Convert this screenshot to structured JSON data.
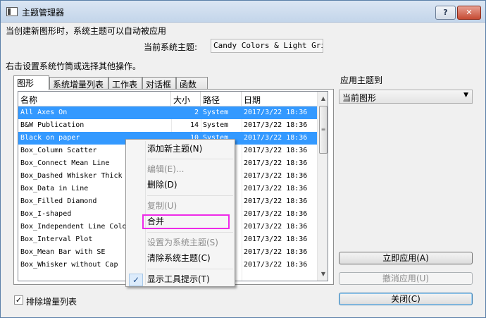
{
  "window": {
    "title": "主题管理器",
    "help_label": "?",
    "close_label": "✕"
  },
  "auto_apply_text": "当创建新图形时，系统主题可以自动被应用",
  "current_theme": {
    "label": "当前系统主题:",
    "value": "Candy Colors & Light Grids"
  },
  "instruction": "右击设置系统竹筒或选择其他操作。",
  "tabs": [
    {
      "label": "图形",
      "active": true
    },
    {
      "label": "系统增量列表",
      "active": false
    },
    {
      "label": "工作表",
      "active": false
    },
    {
      "label": "对话框",
      "active": false
    },
    {
      "label": "函数",
      "active": false
    }
  ],
  "table": {
    "columns": [
      "名称",
      "大小",
      "路径",
      "日期"
    ],
    "rows": [
      {
        "name": "All Axes On",
        "size": "2",
        "path": "System",
        "date": "2017/3/22 18:36",
        "selected": true
      },
      {
        "name": "B&W Publication",
        "size": "14",
        "path": "System",
        "date": "2017/3/22 18:36",
        "selected": false
      },
      {
        "name": "Black on paper",
        "size": "10",
        "path": "System",
        "date": "2017/3/22 18:36",
        "selected": true
      },
      {
        "name": "Box_Column Scatter",
        "size": "",
        "path": "",
        "date": "2017/3/22 18:36",
        "selected": false
      },
      {
        "name": "Box_Connect Mean Line",
        "size": "",
        "path": "",
        "date": "2017/3/22 18:36",
        "selected": false
      },
      {
        "name": "Box_Dashed Whisker Thick",
        "size": "",
        "path": "",
        "date": "2017/3/22 18:36",
        "selected": false
      },
      {
        "name": "Box_Data in Line",
        "size": "",
        "path": "",
        "date": "2017/3/22 18:36",
        "selected": false
      },
      {
        "name": "Box_Filled Diamond",
        "size": "",
        "path": "",
        "date": "2017/3/22 18:36",
        "selected": false
      },
      {
        "name": "Box_I-shaped",
        "size": "",
        "path": "",
        "date": "2017/3/22 18:36",
        "selected": false
      },
      {
        "name": "Box_Independent Line Colo",
        "size": "",
        "path": "",
        "date": "2017/3/22 18:36",
        "selected": false
      },
      {
        "name": "Box_Interval Plot",
        "size": "",
        "path": "",
        "date": "2017/3/22 18:36",
        "selected": false
      },
      {
        "name": "Box_Mean Bar with SE",
        "size": "",
        "path": "",
        "date": "2017/3/22 18:36",
        "selected": false
      },
      {
        "name": "Box_Whisker without Cap",
        "size": "",
        "path": "",
        "date": "2017/3/22 18:36",
        "selected": false
      }
    ]
  },
  "apply_to": {
    "label": "应用主题到",
    "selected": "当前图形"
  },
  "buttons": {
    "apply_now": "立即应用(A)",
    "undo_apply": "撤消应用(U)",
    "close": "关闭(C)"
  },
  "exclude_checkbox": {
    "label": "排除增量列表",
    "checked": true
  },
  "context_menu": {
    "items": [
      {
        "label": "添加新主题(N)",
        "enabled": true
      },
      {
        "label": "编辑(E)...",
        "enabled": false
      },
      {
        "label": "删除(D)",
        "enabled": true
      },
      {
        "label": "复制(U)",
        "enabled": false
      },
      {
        "label": "合并",
        "enabled": true,
        "highlighted": true
      },
      {
        "label": "设置为系统主题(S)",
        "enabled": false
      },
      {
        "label": "清除系统主题(C)",
        "enabled": true
      },
      {
        "label": "显示工具提示(T)",
        "enabled": true,
        "checked": true
      }
    ]
  },
  "colors": {
    "selection": "#3399ff",
    "highlight_box": "#ee2ae8"
  }
}
